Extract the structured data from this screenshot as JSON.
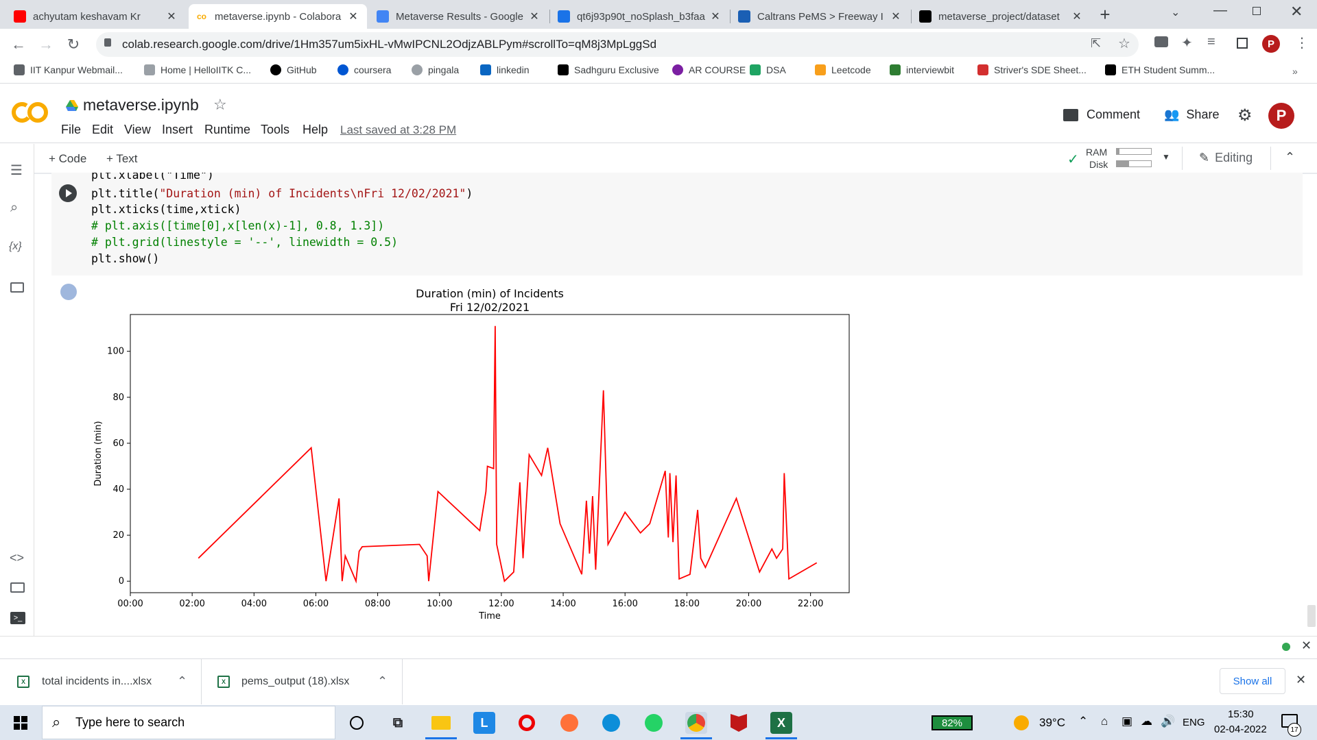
{
  "browser": {
    "tabs": [
      {
        "title": "achyutam keshavam Kr",
        "icon": "youtube-icon",
        "color": "#ff0000"
      },
      {
        "title": "metaverse.ipynb - Colabora",
        "icon": "colab-icon",
        "color": "#f9ab00",
        "active": true
      },
      {
        "title": "Metaverse Results - Google",
        "icon": "google-docs-icon",
        "color": "#4285f4"
      },
      {
        "title": "qt6j93p90t_noSplash_b3faa",
        "icon": "loading-icon",
        "color": "#1a73e8"
      },
      {
        "title": "Caltrans PeMS > Freeway I",
        "icon": "caltrans-icon",
        "color": "#1a5fb4"
      },
      {
        "title": "metaverse_project/dataset",
        "icon": "github-icon",
        "color": "#000000"
      }
    ],
    "url": "colab.research.google.com/drive/1Hm357um5ixHL-vMwIPCNL2OdjzABLPym#scrollTo=qM8j3MpLggSd",
    "bookmarks": [
      {
        "label": "IIT Kanpur Webmail...",
        "icon": "globe-icon"
      },
      {
        "label": "Home | HelloIITK C...",
        "icon": "helloiitk-icon"
      },
      {
        "label": "GitHub",
        "icon": "github-icon"
      },
      {
        "label": "coursera",
        "icon": "coursera-icon"
      },
      {
        "label": "pingala",
        "icon": "pingala-icon"
      },
      {
        "label": "linkedin",
        "icon": "linkedin-icon"
      },
      {
        "label": "Sadhguru Exclusive",
        "icon": "sadhguru-icon"
      },
      {
        "label": "AR COURSE",
        "icon": "ar-course-icon"
      },
      {
        "label": "DSA",
        "icon": "google-drive-icon"
      },
      {
        "label": "Leetcode",
        "icon": "leetcode-icon"
      },
      {
        "label": "interviewbit",
        "icon": "interviewbit-icon"
      },
      {
        "label": "Striver's SDE Sheet...",
        "icon": "tuf-icon"
      },
      {
        "label": "ETH Student Summ...",
        "icon": "eth-icon"
      }
    ]
  },
  "colab": {
    "notebook_title": "metaverse.ipynb",
    "menus": [
      "File",
      "Edit",
      "View",
      "Insert",
      "Runtime",
      "Tools",
      "Help"
    ],
    "last_saved": "Last saved at 3:28 PM",
    "comment_label": "Comment",
    "share_label": "Share",
    "add_code_label": "+ Code",
    "add_text_label": "+ Text",
    "ram_label": "RAM",
    "disk_label": "Disk",
    "editing_label": "Editing",
    "code_lines": [
      "plt.xlabel(\"Time\")",
      "plt.title(\"Duration (min) of Incidents\\nFri 12/02/2021\")",
      "plt.xticks(time,xtick)",
      "# plt.axis([time[0],x[len(x)-1], 0.8, 1.3])",
      "# plt.grid(linestyle = '--', linewidth = 0.5)",
      "plt.show()"
    ]
  },
  "chart_data": {
    "type": "line",
    "title": "Duration (min) of Incidents",
    "subtitle": "Fri 12/02/2021",
    "xlabel": "Time",
    "ylabel": "Duration (min)",
    "xlim": [
      0,
      23.25
    ],
    "ylim": [
      -5,
      116
    ],
    "xticks": [
      0,
      2,
      4,
      6,
      8,
      10,
      12,
      14,
      16,
      18,
      20,
      22
    ],
    "xtick_labels": [
      "00:00",
      "02:00",
      "04:00",
      "06:00",
      "08:00",
      "10:00",
      "12:00",
      "14:00",
      "16:00",
      "18:00",
      "20:00",
      "22:00"
    ],
    "yticks": [
      0,
      20,
      40,
      60,
      80,
      100
    ],
    "grid": false,
    "legend": "none",
    "color": "#ff0000",
    "series": [
      {
        "x": [
          2.2,
          5.85,
          6.33,
          6.75,
          6.85,
          6.95,
          7.3,
          7.4,
          7.5,
          9.35,
          9.6,
          9.65,
          9.95,
          11.3,
          11.5,
          11.55,
          11.75,
          11.8,
          11.85,
          12.1,
          12.4,
          12.6,
          12.7,
          12.9,
          13.3,
          13.5,
          13.9,
          14.6,
          14.75,
          14.85,
          14.95,
          15.05,
          15.3,
          15.45,
          16.0,
          16.5,
          16.8,
          17.3,
          17.4,
          17.45,
          17.55,
          17.65,
          17.75,
          18.1,
          18.35,
          18.45,
          18.6,
          19.6,
          20.35,
          20.75,
          20.9,
          21.1,
          21.15,
          21.3,
          22.2
        ],
        "y": [
          10,
          58,
          0,
          36,
          0,
          11,
          0,
          13,
          15,
          16,
          11,
          0,
          39,
          22,
          39,
          50,
          49,
          111,
          16,
          0,
          4,
          43,
          10,
          55,
          46,
          58,
          25,
          3,
          35,
          12,
          37,
          5,
          83,
          16,
          30,
          21,
          25,
          48,
          19,
          47,
          17,
          46,
          1,
          3,
          31,
          10,
          6,
          36,
          4,
          14,
          10,
          14,
          47,
          1,
          8
        ]
      }
    ]
  },
  "downloads": [
    {
      "name": "total incidents in....xlsx"
    },
    {
      "name": "pems_output (18).xlsx"
    }
  ],
  "show_all_label": "Show all",
  "taskbar": {
    "search_placeholder": "Type here to search",
    "battery": "82%",
    "temperature": "39°C",
    "language": "ENG",
    "time": "15:30",
    "date": "02-04-2022",
    "notification_count": "17"
  }
}
